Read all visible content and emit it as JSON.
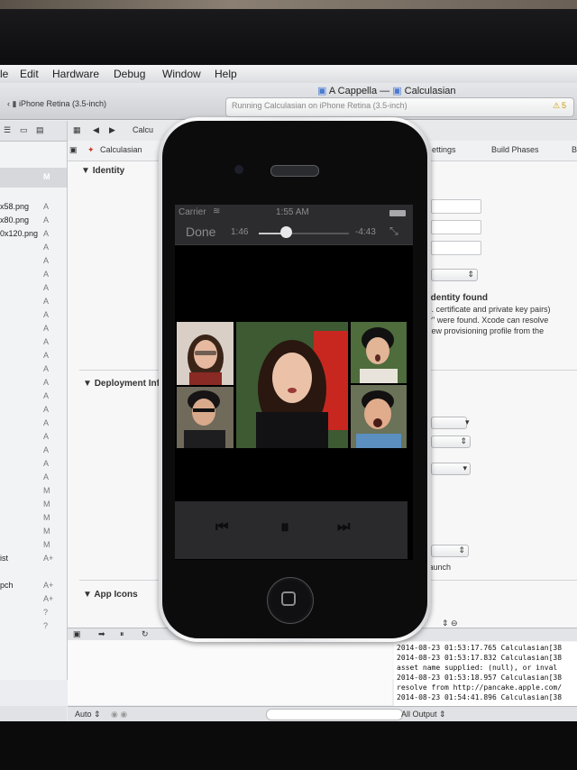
{
  "menubar": {
    "items": [
      "le",
      "Edit",
      "Hardware",
      "Debug",
      "Window",
      "Help"
    ]
  },
  "window": {
    "title_project": "A Cappella",
    "title_separator": "—",
    "title_file": "Calculasian"
  },
  "toolbar": {
    "scheme_device": "iPhone Retina (3.5-inch)",
    "status_text": "Running Calculasian on iPhone Retina (3.5-inch)",
    "warning_count": "5"
  },
  "navigator": {
    "header_flag": "M",
    "files": [
      {
        "name": "x58.png",
        "flag": "A"
      },
      {
        "name": "x80.png",
        "flag": "A"
      },
      {
        "name": "0x120.png",
        "flag": "A"
      },
      {
        "name": "",
        "flag": "A"
      },
      {
        "name": "",
        "flag": "A"
      },
      {
        "name": "",
        "flag": "A"
      },
      {
        "name": "",
        "flag": "A"
      },
      {
        "name": "",
        "flag": "A"
      },
      {
        "name": "",
        "flag": "A"
      },
      {
        "name": "",
        "flag": "A"
      },
      {
        "name": "",
        "flag": "A"
      },
      {
        "name": "",
        "flag": "A"
      },
      {
        "name": "",
        "flag": "A"
      },
      {
        "name": "",
        "flag": "A"
      },
      {
        "name": "",
        "flag": "A"
      },
      {
        "name": "",
        "flag": "A"
      },
      {
        "name": "",
        "flag": "A"
      },
      {
        "name": "",
        "flag": "A"
      },
      {
        "name": "",
        "flag": "A"
      },
      {
        "name": "",
        "flag": "A"
      },
      {
        "name": "",
        "flag": "A"
      },
      {
        "name": "",
        "flag": "M"
      },
      {
        "name": "",
        "flag": "M"
      },
      {
        "name": "",
        "flag": "M"
      },
      {
        "name": "",
        "flag": "M"
      },
      {
        "name": "",
        "flag": "M"
      },
      {
        "name": "ist",
        "flag": "A+"
      },
      {
        "name": "",
        "flag": ""
      },
      {
        "name": "pch",
        "flag": "A+"
      },
      {
        "name": "",
        "flag": "A+"
      },
      {
        "name": "",
        "flag": "?"
      },
      {
        "name": "",
        "flag": "?"
      }
    ]
  },
  "editor": {
    "jump_partial": "Calcu",
    "target": "Calculasian",
    "tabs": [
      "ettings",
      "Build Phases",
      "B"
    ],
    "sections": {
      "identity": "Identity",
      "deployment": "Deployment Inf",
      "app_icons": "App Icons"
    },
    "signing_title": "g identity found",
    "signing_lines": [
      "(i.e. certificate and private key pairs)",
      "per\" were found.  Xcode can resolve",
      "a new provisioning profile from the"
    ],
    "launch_text": "n launch"
  },
  "console": {
    "lines": [
      "2014-08-23 01:53:17.765 Calculasian[38",
      "2014-08-23 01:53:17.832 Calculasian[38",
      "asset name supplied: (null), or inval",
      "2014-08-23 01:53:18.957 Calculasian[38",
      "resolve from http://pancake.apple.com/",
      "2014-08-23 01:54:41.896 Calculasian[38"
    ],
    "output_filter": "All Output ⇕"
  },
  "debug": {
    "auto_label": "Auto ⇕"
  },
  "simulator": {
    "carrier": "Carrier",
    "time": "1:55 AM",
    "done_label": "Done",
    "elapsed": "1:46",
    "remaining": "-4:43",
    "progress_fraction": 0.3
  },
  "player": {
    "prev_icon": "⏮",
    "pause_icon": "⏸",
    "next_icon": "⏭"
  },
  "colors": {
    "accent": "#c23a2a",
    "screen_bg": "#ecedf0",
    "phone_bar": "#2c2c2e"
  }
}
